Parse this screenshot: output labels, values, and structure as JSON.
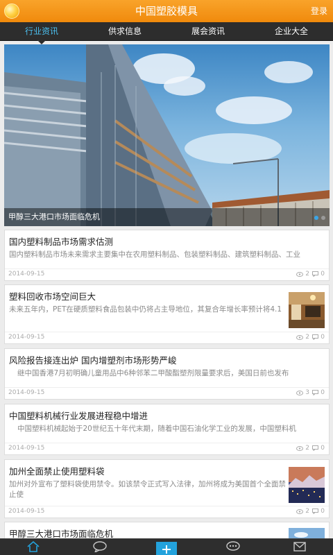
{
  "header": {
    "title": "中国塑胶模具",
    "login_label": "登录"
  },
  "tabs": [
    {
      "label": "行业资讯"
    },
    {
      "label": "供求信息"
    },
    {
      "label": "展会资讯"
    },
    {
      "label": "企业大全"
    }
  ],
  "banner": {
    "caption": "甲醇三大港口市场面临危机"
  },
  "articles": [
    {
      "title": "国内塑料制品市场需求估测",
      "summary": "国内塑料制品市场未来需求主要集中在农用塑料制品、包装塑料制品、建筑塑料制品、工业",
      "date": "2014-09-15",
      "views": "2",
      "comments": "0"
    },
    {
      "title": "塑料回收市场空间巨大",
      "summary": "未来五年内，PET在硬质塑料食品包装中仍将占主导地位，其复合年增长率预计将4.1",
      "date": "2014-09-15",
      "views": "2",
      "comments": "0"
    },
    {
      "title": "风险报告接连出炉 国内增塑剂市场形势严峻",
      "summary": "继中国香港7月初明确儿童用品中6种邻苯二甲酸酯塑剂限量要求后，美国日前也发布",
      "date": "2014-09-15",
      "views": "3",
      "comments": "0"
    },
    {
      "title": "中国塑料机械行业发展进程稳中增进",
      "summary": "中国塑料机械起始于20世纪五十年代末期，随着中国石油化学工业的发展，中国塑料机",
      "date": "2014-09-15",
      "views": "2",
      "comments": "0"
    },
    {
      "title": "加州全面禁止使用塑料袋",
      "summary": "加州对外宣布了塑料袋使用禁令。如该禁令正式写入法律，加州将成为美国首个全面禁止使",
      "date": "2014-09-15",
      "views": "2",
      "comments": "0"
    },
    {
      "title": "甲醇三大港口市场面临危机"
    }
  ],
  "colors": {
    "accent": "#f39319",
    "tab_active": "#4cc0f0",
    "nav_active": "#23a2dc"
  },
  "bottom_nav": [
    {
      "icon": "home-icon"
    },
    {
      "icon": "chat-icon"
    },
    {
      "icon": "plus-icon"
    },
    {
      "icon": "message-icon"
    },
    {
      "icon": "mail-icon"
    }
  ]
}
